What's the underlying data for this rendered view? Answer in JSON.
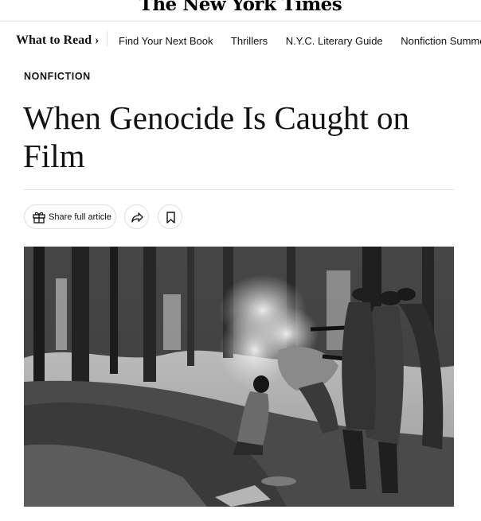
{
  "masthead": {
    "logo_text": "The New York Times"
  },
  "nav": {
    "what_to_read": "What to Read ›",
    "links": [
      "Find Your Next Book",
      "Thrillers",
      "N.Y.C. Literary Guide",
      "Nonfiction Summer Previ"
    ]
  },
  "article": {
    "kicker": "NONFICTION",
    "headline": "When Genocide Is Caught on Film"
  },
  "tools": {
    "share_full_label": "Share full article"
  },
  "icons": {
    "gift": "gift-icon",
    "share": "share-icon",
    "bookmark": "bookmark-icon"
  }
}
